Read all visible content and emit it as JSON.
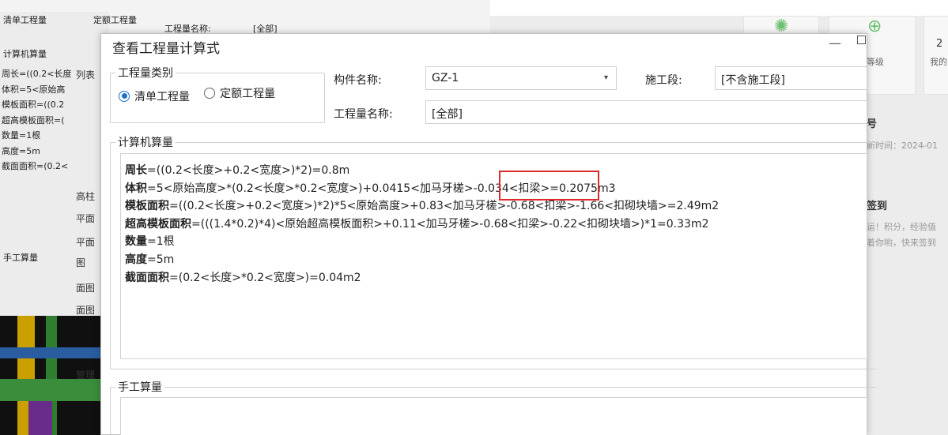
{
  "background_left": {
    "radio_qty": "清单工程量",
    "radio_quota": "定额工程量",
    "qty_name_label": "工程量名称:",
    "qty_name_value": "[全部]",
    "calc_legend": "计算机算量",
    "calc_lines": [
      "周长=((0.2<长度",
      "体积=5<原始高",
      "模板面积=((0.2",
      "超高模板面积=(",
      "数量=1根",
      "高度=5m",
      "截面面积=(0.2<"
    ],
    "manual_legend": "手工算量",
    "tools": [
      "列表",
      "高柱",
      "平面",
      "平面",
      "图",
      "面图",
      "面图",
      "管理"
    ]
  },
  "background_right": {
    "tiles": [
      {
        "label": "等级",
        "glyph": "✺"
      },
      {
        "label": "我的",
        "glyph": "⊕"
      }
    ],
    "tile_number": "2",
    "news_title": "号",
    "news_time": "新时间：2024-01",
    "sign_title": "签到",
    "sign_desc_1": "运！积分，经验值",
    "sign_desc_2": "着你哟，快来签到"
  },
  "dialog": {
    "title": "查看工程量计算式",
    "category_legend": "工程量类别",
    "radio_qty": "清单工程量",
    "radio_quota": "定额工程量",
    "component_label": "构件名称:",
    "component_value": "GZ-1",
    "stage_label": "施工段:",
    "stage_value": "[不含施工段]",
    "qty_name_label": "工程量名称:",
    "qty_name_value": "[全部]",
    "calc_legend": "计算机算量",
    "calc_lines": [
      {
        "name": "周长",
        "formula": "=((0.2<长度>+0.2<宽度>)*2)=0.8m"
      },
      {
        "name": "体积",
        "formula": "=5<原始高度>*(0.2<长度>*0.2<宽度>)+0.0415<加马牙槎>-0.034<扣梁>=0.2075m3"
      },
      {
        "name": "模板面积",
        "formula": "=((0.2<长度>+0.2<宽度>)*2)*5<原始高度>+0.83<加马牙槎>-0.68<扣梁>-1.66<扣砌块墙>=2.49m2"
      },
      {
        "name": "超高模板面积",
        "formula": "=(((1.4*0.2)*4)<原始超高模板面积>+0.11<加马牙槎>-0.68<扣梁>-0.22<扣砌块墙>)*1=0.33m2"
      },
      {
        "name": "数量",
        "formula": "=1根"
      },
      {
        "name": "高度",
        "formula": "=5m"
      },
      {
        "name": "截面面积",
        "formula": "=(0.2<长度>*0.2<宽度>)=0.04m2"
      }
    ],
    "manual_legend": "手工算量"
  },
  "colors": {
    "highlight_border": "#e02a2a",
    "radio_accent": "#1f6fd1"
  }
}
